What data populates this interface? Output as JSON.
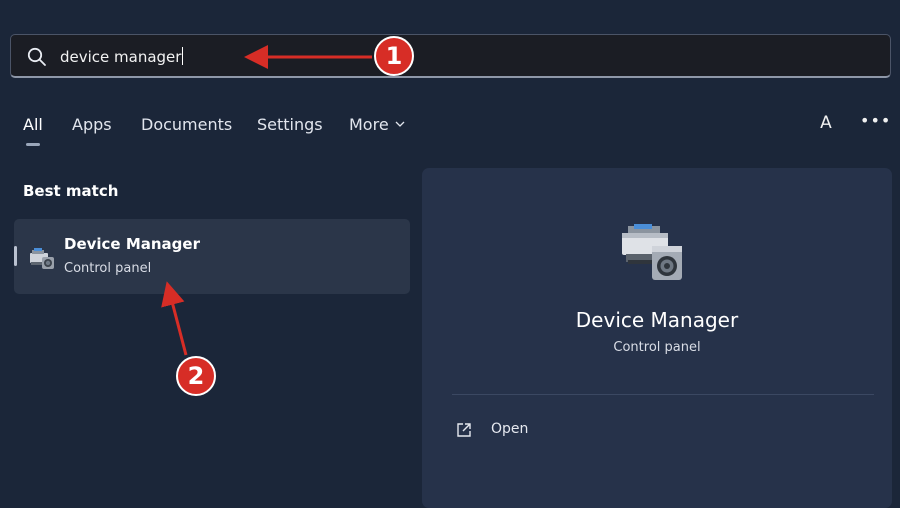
{
  "search": {
    "value": "device manager"
  },
  "tabs": [
    {
      "label": "All"
    },
    {
      "label": "Apps"
    },
    {
      "label": "Documents"
    },
    {
      "label": "Settings"
    },
    {
      "label": "More"
    }
  ],
  "active_tab": "All",
  "header": {
    "avatar_initial": "A",
    "more_options": "•••"
  },
  "results": {
    "section_label": "Best match",
    "best_match": {
      "title": "Device Manager",
      "subtitle": "Control panel"
    }
  },
  "preview": {
    "title": "Device Manager",
    "subtitle": "Control panel",
    "actions": [
      {
        "label": "Open",
        "icon": "open-external-icon"
      }
    ]
  },
  "annotations": [
    {
      "label": "1"
    },
    {
      "label": "2"
    }
  ],
  "colors": {
    "background": "#1b2639",
    "search_bg": "#1b1d24",
    "result_highlight": "#2b3649",
    "preview_bg": "#26324a",
    "annotation_red": "#d72d26"
  }
}
